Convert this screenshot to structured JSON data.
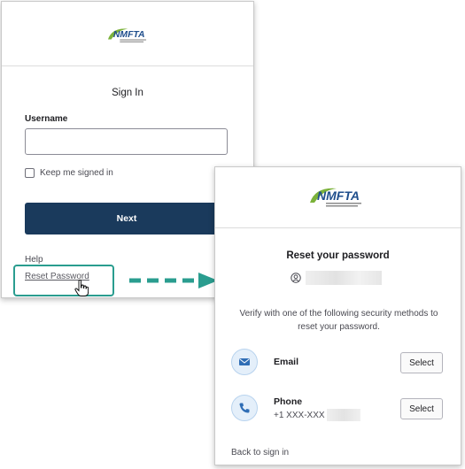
{
  "signin": {
    "logo_text": "NMFTA",
    "title": "Sign In",
    "username_label": "Username",
    "username_value": "",
    "keep_signed_in_label": "Keep me signed in",
    "next_label": "Next",
    "help_label": "Help",
    "reset_link_label": "Reset Password"
  },
  "reset": {
    "logo_text": "NMFTA",
    "title": "Reset your password",
    "description": "Verify with one of the following security methods to reset your password.",
    "methods": [
      {
        "name": "Email",
        "detail": "",
        "icon": "email-icon",
        "select_label": "Select"
      },
      {
        "name": "Phone",
        "detail": "+1 XXX-XXX",
        "icon": "phone-icon",
        "select_label": "Select"
      }
    ],
    "back_link_label": "Back to sign in"
  },
  "colors": {
    "brand_navy": "#1a3a5c",
    "logo_green": "#7bb23a",
    "logo_blue": "#1f4e8c",
    "highlight_teal": "#2a9d8f",
    "icon_bg": "#e4effa",
    "icon_blue": "#2f6db5"
  }
}
